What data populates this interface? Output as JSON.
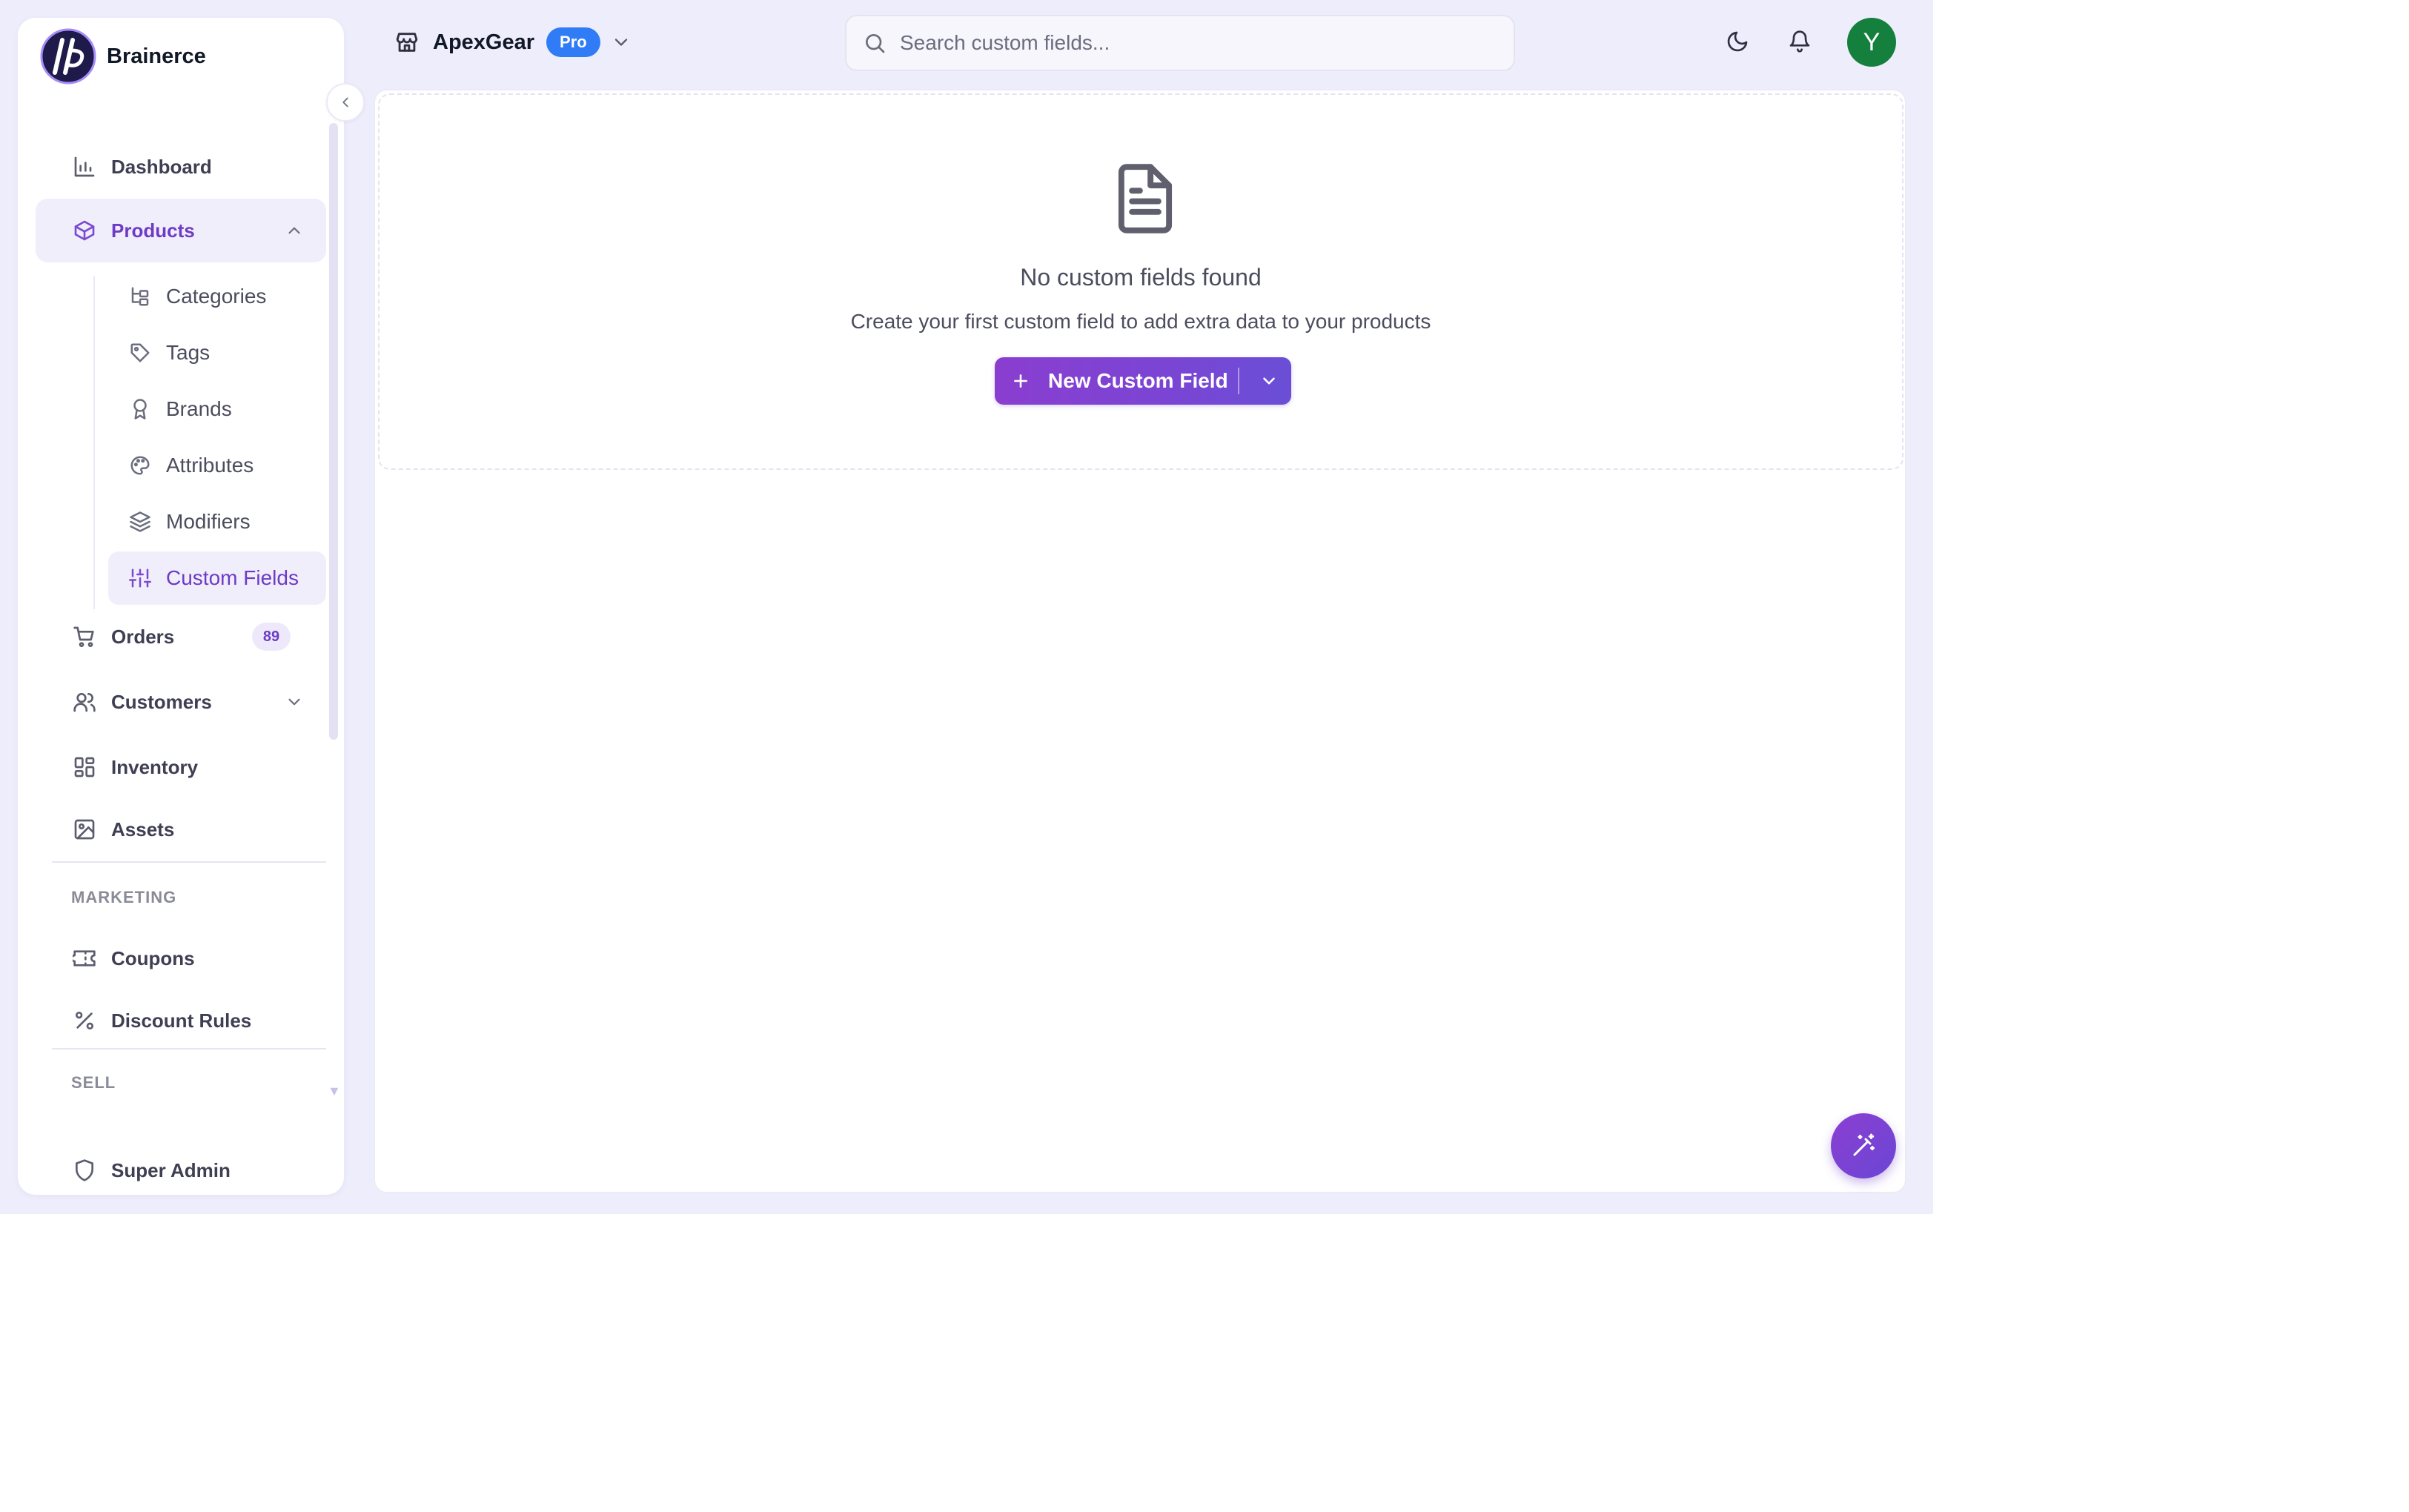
{
  "brand": {
    "name": "Brainerce"
  },
  "sidebar": {
    "items": [
      {
        "id": "dashboard",
        "label": "Dashboard",
        "icon": "bar-chart-icon"
      },
      {
        "id": "products",
        "label": "Products",
        "icon": "box-icon",
        "expanded": true
      },
      {
        "id": "orders",
        "label": "Orders",
        "icon": "cart-icon",
        "badge": "89"
      },
      {
        "id": "customers",
        "label": "Customers",
        "icon": "users-icon",
        "expanded": false
      },
      {
        "id": "inventory",
        "label": "Inventory",
        "icon": "grid-icon"
      },
      {
        "id": "assets",
        "label": "Assets",
        "icon": "image-icon"
      }
    ],
    "product_subitems": [
      {
        "label": "Categories",
        "icon": "tree-icon"
      },
      {
        "label": "Tags",
        "icon": "tag-icon"
      },
      {
        "label": "Brands",
        "icon": "award-icon"
      },
      {
        "label": "Attributes",
        "icon": "palette-icon"
      },
      {
        "label": "Modifiers",
        "icon": "layers-icon"
      },
      {
        "label": "Custom Fields",
        "icon": "sliders-icon",
        "active": true
      }
    ],
    "sections": {
      "marketing": "MARKETING",
      "sell": "SELL"
    },
    "marketing_items": [
      {
        "label": "Coupons",
        "icon": "ticket-icon"
      },
      {
        "label": "Discount Rules",
        "icon": "percent-icon"
      }
    ],
    "footer": {
      "label": "Super Admin",
      "icon": "shield-icon"
    }
  },
  "topbar": {
    "store_name": "ApexGear",
    "plan_badge": "Pro",
    "search_placeholder": "Search custom fields...",
    "avatar_initial": "Y"
  },
  "empty_state": {
    "title": "No custom fields found",
    "description": "Create your first custom field to add extra data to your products",
    "button_label": "New Custom Field"
  },
  "colors": {
    "accent": "#7c4dd8",
    "pro_badge": "#2f7cf6",
    "avatar": "#15803d",
    "app_background": "#eeedfb"
  }
}
